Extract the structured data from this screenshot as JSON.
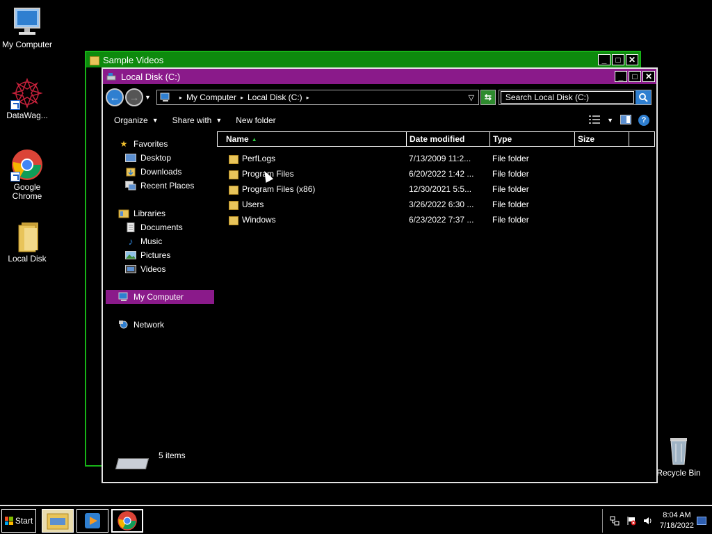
{
  "desktop": {
    "icons": [
      {
        "label": "My Computer",
        "icon": "computer-icon"
      },
      {
        "label": "DataWag...",
        "icon": "datawag-icon"
      },
      {
        "label": "Google Chrome",
        "icon": "chrome-icon"
      },
      {
        "label": "Local Disk",
        "icon": "folder-icon"
      },
      {
        "label": "Recycle Bin",
        "icon": "recycle-bin-icon"
      }
    ]
  },
  "back_window": {
    "title": "Sample Videos",
    "frame_color": "#17b317",
    "title_color": "#0d8a0d"
  },
  "window": {
    "title": "Local Disk (C:)",
    "frame_color": "#e3e3e3",
    "title_color": "#8a1a8a",
    "buttons": {
      "minimize": "_",
      "maximize": "□",
      "close": "✕"
    },
    "address": {
      "crumbs": [
        "My Computer",
        "Local Disk (C:)"
      ]
    },
    "search": {
      "placeholder": "Search Local Disk (C:)"
    },
    "toolbar": {
      "organize": "Organize",
      "share_with": "Share with",
      "new_folder": "New folder"
    },
    "nav": {
      "favorites": "Favorites",
      "favorites_items": [
        "Desktop",
        "Downloads",
        "Recent Places"
      ],
      "libraries": "Libraries",
      "libraries_items": [
        "Documents",
        "Music",
        "Pictures",
        "Videos"
      ],
      "my_computer": "My Computer",
      "network": "Network"
    },
    "columns": {
      "name": "Name",
      "date": "Date modified",
      "type": "Type",
      "size": "Size"
    },
    "files": [
      {
        "name": "PerfLogs",
        "date": "7/13/2009 11:2...",
        "type": "File folder"
      },
      {
        "name": "Program Files",
        "date": "6/20/2022 1:42 ...",
        "type": "File folder"
      },
      {
        "name": "Program Files (x86)",
        "date": "12/30/2021 5:5...",
        "type": "File folder"
      },
      {
        "name": "Users",
        "date": "3/26/2022 6:30 ...",
        "type": "File folder"
      },
      {
        "name": "Windows",
        "date": "6/23/2022 7:37 ...",
        "type": "File folder"
      }
    ],
    "status": "5 items"
  },
  "taskbar": {
    "start": "Start",
    "clock_time": "8:04 AM",
    "clock_date": "7/18/2022"
  },
  "colors": {
    "selection": "#8a1a8a",
    "accent_blue": "#2f7fd0",
    "folder": "#e8c45a"
  }
}
